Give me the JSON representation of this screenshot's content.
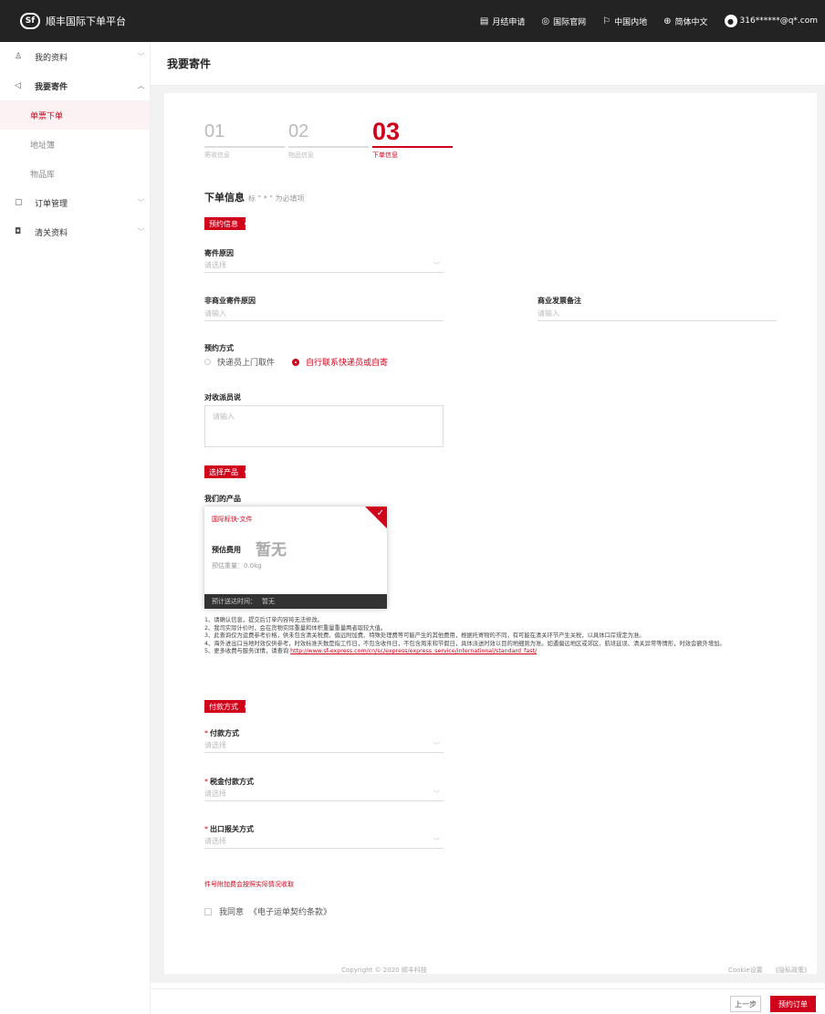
{
  "app": {
    "logo_mark": "Sf",
    "logo_text": "顺丰国际下单平台"
  },
  "topnav": {
    "items": [
      {
        "icon": "calendar-icon",
        "label": "月结申请"
      },
      {
        "icon": "globe-site-icon",
        "label": "国际官网"
      },
      {
        "icon": "flag-icon",
        "label": "中国内地"
      },
      {
        "icon": "language-icon",
        "label": "简体中文"
      }
    ],
    "user_email": "316******@q*.com"
  },
  "sidebar": {
    "my_profile": "我的资料",
    "send": "我要寄件",
    "send_subs": [
      "单票下单",
      "地址簿",
      "物品库"
    ],
    "orders": "订单管理",
    "customs": "清关资料"
  },
  "page": {
    "title": "我要寄件"
  },
  "steps": [
    {
      "num": "01",
      "label": "寄收信息"
    },
    {
      "num": "02",
      "label": "物品信息"
    },
    {
      "num": "03",
      "label": "下单信息"
    }
  ],
  "form": {
    "title": "下单信息",
    "hint": "标 \" * \" 为必填项",
    "section_booking": "预约信息",
    "reason_label": "寄件原因",
    "reason_placeholder": "请选择",
    "noncommercial_label": "非商业寄件原因",
    "noncommercial_placeholder": "请输入",
    "invoice_label": "商业发票备注",
    "invoice_placeholder": "请输入",
    "booking_method_label": "预约方式",
    "booking_option_1": "快递员上门取件",
    "booking_option_2": "自行联系快递员或自寄",
    "courier_note_label": "对收派员说",
    "courier_note_placeholder": "请输入",
    "section_product": "选择产品",
    "our_products_label": "我们的产品",
    "section_payment": "付款方式",
    "payment_label": "付款方式",
    "payment_placeholder": "请选择",
    "tax_label": "税金付款方式",
    "tax_placeholder": "请选择",
    "export_label": "出口报关方式",
    "export_placeholder": "请选择",
    "alert": "件号附加费会按照实际情况收取",
    "agree_prefix": "我同意",
    "agree_link": "《电子运单契约条款》"
  },
  "product": {
    "name": "国际标快-文件",
    "fee_label": "预估费用",
    "fee_value": "暂无",
    "weight": "预估重量：0.0kg",
    "eta_label": "预计送达时间：",
    "eta_value": "暂无"
  },
  "notes": {
    "lines": [
      "1、请确认信息，提交后订单内容将无法修改。",
      "2、我司实际计价时，会在货物实际重量和体积重量重量两者取较大值。",
      "3、此查询仅为运费参考价格，供未包含清关税费、偏远附加费、特殊处理费等可能产生的其他费用，根据托寄物的不同，有可能在清关环节产生关税，以具体口岸规定为准。",
      "4、海外进出口当地时效仅供参考，时效标准天数是指工作日，不包含收件日，不包含周末和节假日，具体派送时效以目的地细则为准。如遇偏远地区或郊区、航班延误、清关异常等情形，时效会额外增加。"
    ],
    "line5_prefix": "5、更多收费与服务详情，请查询 ",
    "link": "http://www.sf-express.com/cn/sc/express/express_service/international/standard_fast/"
  },
  "footer": {
    "copyright": "Copyright © 2020 顺丰科技",
    "cookie": "Cookie设置",
    "privacy": "《隐私政策》"
  },
  "actions": {
    "prev": "上一步",
    "submit": "预约订单"
  },
  "colors": {
    "brand_red": "#d0021b",
    "topbar_bg": "#232323"
  }
}
